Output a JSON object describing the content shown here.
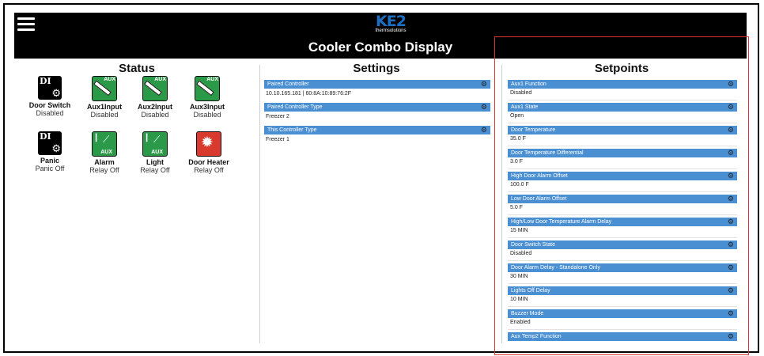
{
  "header": {
    "logo_text": "KE2",
    "logo_sub": "thermsolutions",
    "title": "Cooler Combo Display",
    "menu_icon": "hamburger-menu-icon"
  },
  "columns": {
    "status": "Status",
    "settings": "Settings",
    "setpoints": "Setpoints"
  },
  "status": [
    {
      "name": "Door Switch",
      "state": "Disabled",
      "icon": "digital-input-icon"
    },
    {
      "name": "Aux1Input",
      "state": "Disabled",
      "icon": "aux-probe-icon"
    },
    {
      "name": "Aux2Input",
      "state": "Disabled",
      "icon": "aux-probe-icon"
    },
    {
      "name": "Aux3Input",
      "state": "Disabled",
      "icon": "aux-probe-icon"
    },
    {
      "name": "Panic",
      "state": "Panic Off",
      "icon": "digital-input-icon"
    },
    {
      "name": "Alarm",
      "state": "Relay Off",
      "icon": "aux-relay-icon"
    },
    {
      "name": "Light",
      "state": "Relay Off",
      "icon": "aux-relay-icon"
    },
    {
      "name": "Door Heater",
      "state": "Relay Off",
      "icon": "heater-icon"
    }
  ],
  "icon_text": {
    "di": "DI",
    "aux": "AUX"
  },
  "settings": [
    {
      "label": "Paired Controller",
      "value": "10.10.165.181 | 60:8A:10:89:76:2F"
    },
    {
      "label": "Paired Controller Type",
      "value": "Freezer 2"
    },
    {
      "label": "This Controller Type",
      "value": "Freezer 1"
    }
  ],
  "setpoints": [
    {
      "label": "Aux1 Function",
      "value": "Disabled"
    },
    {
      "label": "Aux1 State",
      "value": "Open"
    },
    {
      "label": "Door Temperature",
      "value": "35.0 F"
    },
    {
      "label": "Door Temperature Differential",
      "value": "3.0 F"
    },
    {
      "label": "High Door Alarm Offset",
      "value": "100.0 F"
    },
    {
      "label": "Low Door Alarm Offset",
      "value": "5.0 F"
    },
    {
      "label": "High/Low Door Temperature Alarm Delay",
      "value": "15 MIN"
    },
    {
      "label": "Door Switch State",
      "value": "Disabled"
    },
    {
      "label": "Door Alarm Delay - Standalone Only",
      "value": "30 MIN"
    },
    {
      "label": "Lights Off Delay",
      "value": "10 MIN"
    },
    {
      "label": "Buzzer Mode",
      "value": "Enabled"
    },
    {
      "label": "Aux Temp2 Function",
      "value": ""
    }
  ],
  "colors": {
    "bar": "#4a8fd2",
    "aux_icon": "#2a9a48",
    "heater_icon": "#d83a2e",
    "highlight": "#e03030"
  }
}
